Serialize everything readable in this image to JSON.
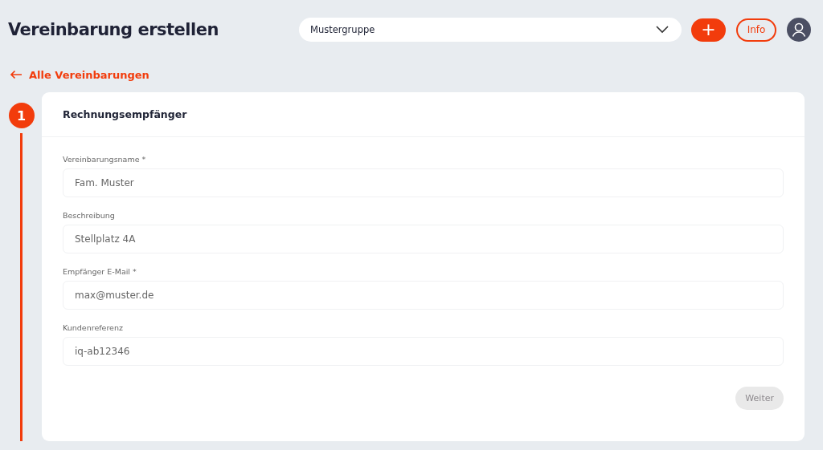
{
  "header": {
    "title": "Vereinbarung erstellen",
    "group_select": {
      "value": "Mustergruppe"
    },
    "add_button": {
      "label": "+"
    },
    "info_button": {
      "label": "Info"
    }
  },
  "back_link": {
    "label": "Alle Vereinbarungen"
  },
  "step": {
    "number": "1",
    "active": true
  },
  "card": {
    "title": "Rechnungsempfänger",
    "fields": [
      {
        "label": "Vereinbarungsname *",
        "value": "Fam. Muster"
      },
      {
        "label": "Beschreibung",
        "value": "Stellplatz 4A"
      },
      {
        "label": "Empfänger E-Mail *",
        "value": "max@muster.de"
      },
      {
        "label": "Kundenreferenz",
        "value": "iq-ab12346"
      }
    ],
    "next_button": {
      "label": "Weiter",
      "disabled": true
    }
  }
}
